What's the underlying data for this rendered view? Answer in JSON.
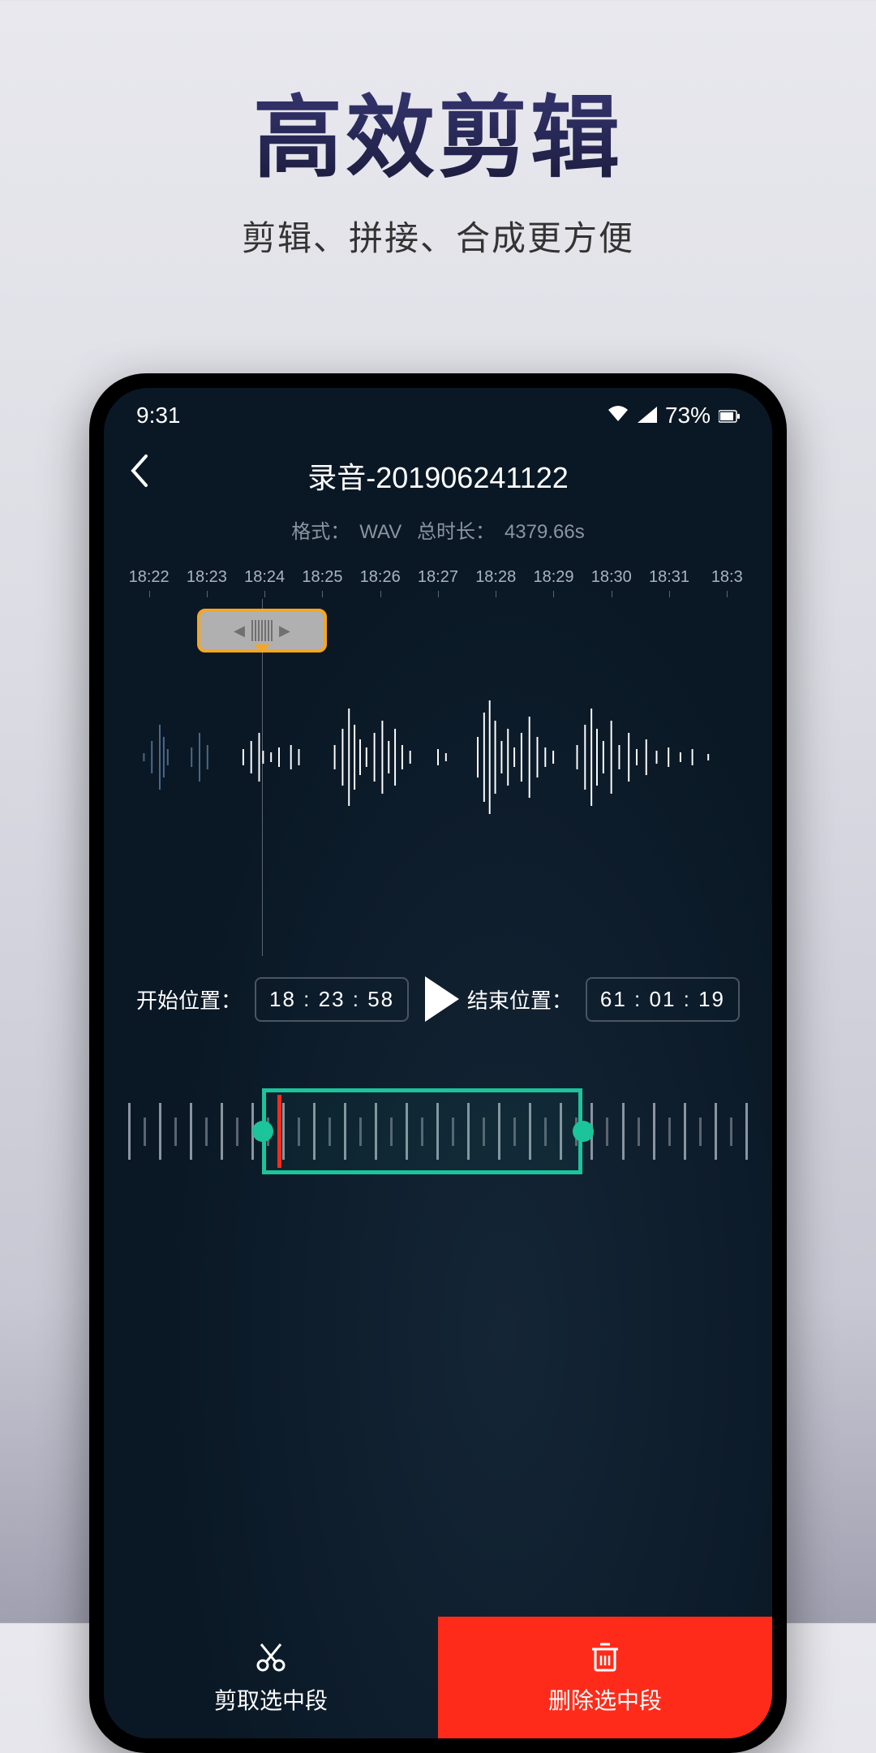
{
  "promo": {
    "title": "高效剪辑",
    "subtitle": "剪辑、拼接、合成更方便"
  },
  "statusbar": {
    "time": "9:31",
    "battery": "73%"
  },
  "appbar": {
    "title": "录音-201906241122"
  },
  "meta": {
    "format_label": "格式：",
    "format_value": "WAV",
    "duration_label": "总时长：",
    "duration_value": "4379.66s"
  },
  "timeline": {
    "ticks": [
      "18:22",
      "18:23",
      "18:24",
      "18:25",
      "18:26",
      "18:27",
      "18:28",
      "18:29",
      "18:30",
      "18:31",
      "18:3"
    ]
  },
  "controls": {
    "start_label": "开始位置：",
    "start_value": "18 : 23 : 58",
    "end_label": "结束位置：",
    "end_value": "61 : 01 : 19"
  },
  "actions": {
    "cut_label": "剪取选中段",
    "delete_label": "删除选中段"
  }
}
